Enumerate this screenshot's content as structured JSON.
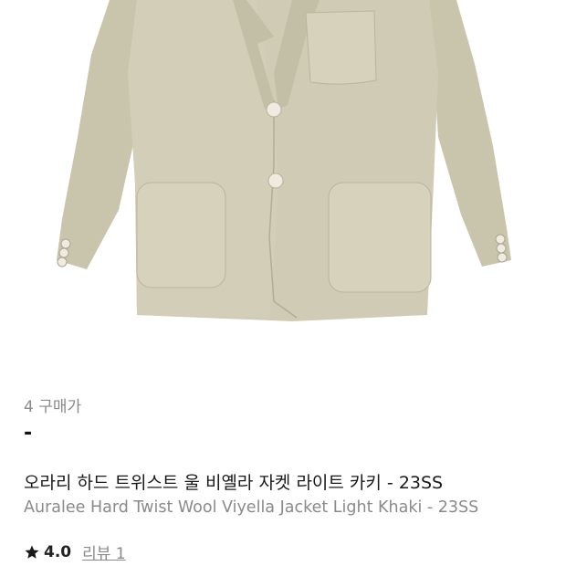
{
  "product": {
    "image_alt": "khaki wool jacket",
    "size_text": "4 구매가",
    "price_text": "-",
    "title_ko": "오라리 하드 트위스트 울 비옐라 자켓 라이트 카키 - 23SS",
    "title_en": "Auralee Hard Twist Wool Viyella Jacket Light Khaki - 23SS",
    "rating": "4.0",
    "review_label": "리뷰 1"
  },
  "colors": {
    "jacket": "#cfcbb4",
    "jacket_shadow": "#b7b39b",
    "button": "#efebe0"
  },
  "icons": {
    "rating": "star-icon"
  }
}
